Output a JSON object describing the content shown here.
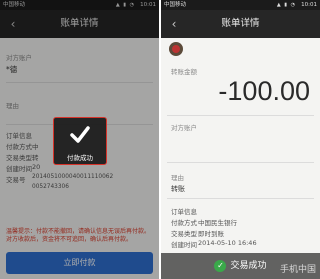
{
  "left": {
    "status": {
      "carrier": "中国移动",
      "icons": "▲ ▮ ◔",
      "time": "10:01"
    },
    "title": "账单详情",
    "payee_label": "对方账户",
    "payee_name": "*德",
    "reason_label": "理由",
    "order_label": "订单信息",
    "order_rows": [
      {
        "label": "付款方式",
        "value": "中"
      },
      {
        "label": "交易类型",
        "value": "转"
      },
      {
        "label": "创建时间",
        "value": "20"
      },
      {
        "label": "交易号",
        "value": "2014051000040011110062"
      }
    ],
    "order_number_cont": "0052743306",
    "warning": "温馨提示：付款不能撤回，请确认信息无误后再付款。对方收款后，资金将不可追回，确认后再付款。",
    "pay_button": "立即付款",
    "toast": "付款成功",
    "colors": {
      "accent": "#2e6fd0",
      "toast_border": "#d7332a",
      "warning": "#d93b2a"
    }
  },
  "right": {
    "status": {
      "carrier": "中国移动",
      "icons": "▲ ▮ ◔",
      "time": "10:01"
    },
    "title": "账单详情",
    "amount_label": "转账金额",
    "amount": "-100.00",
    "payee_label": "对方账户",
    "reason_label": "理由",
    "reason_value": "转账",
    "order_label": "订单信息",
    "order_rows": [
      {
        "label": "付款方式",
        "value": "中国民生银行"
      },
      {
        "label": "交易类型",
        "value": "即时到账"
      },
      {
        "label": "创建时间",
        "value": "2014-05-10 16:46"
      }
    ],
    "toast": "交易成功",
    "watermark": "手机中国"
  }
}
